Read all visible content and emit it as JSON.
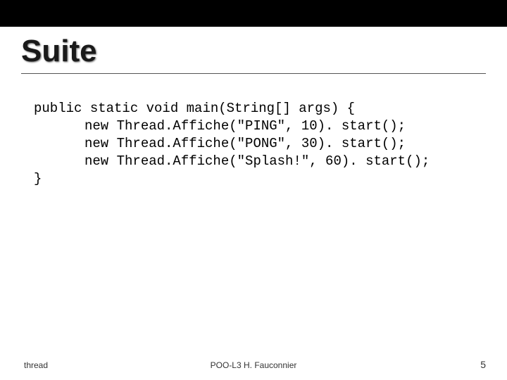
{
  "title": "Suite",
  "code": {
    "line1": "public static void main(String[] args) {",
    "line2": "new Thread.Affiche(\"PING\", 10). start();",
    "line3": "new Thread.Affiche(\"PONG\", 30). start();",
    "line4": "new Thread.Affiche(\"Splash!\", 60). start();",
    "line5": "}"
  },
  "footer": {
    "left": "thread",
    "center": "POO-L3 H. Fauconnier",
    "page": "5"
  }
}
